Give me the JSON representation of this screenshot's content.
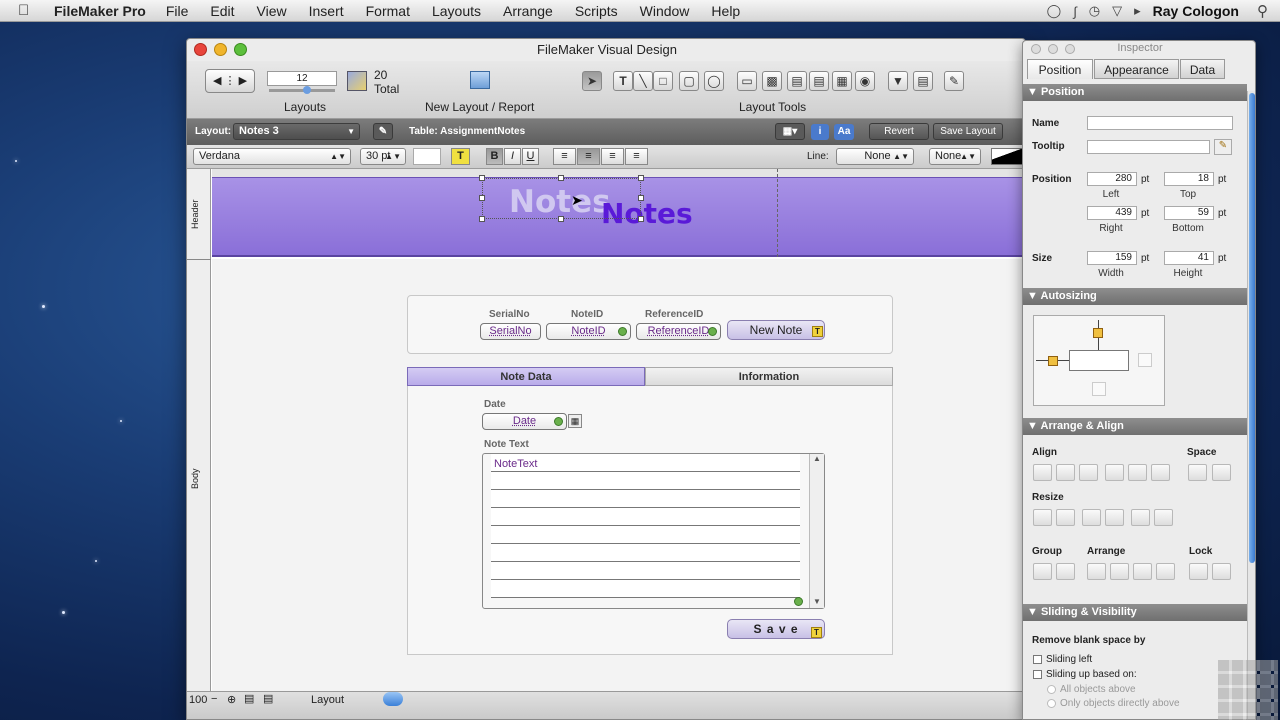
{
  "menubar": {
    "app": "FileMaker Pro",
    "items": [
      "File",
      "Edit",
      "View",
      "Insert",
      "Format",
      "Layouts",
      "Arrange",
      "Scripts",
      "Window",
      "Help"
    ],
    "user": "Ray Cologon"
  },
  "window": {
    "title": "FileMaker Visual Design"
  },
  "toolbar": {
    "record_number": "12",
    "total_count": "20",
    "total_label": "Total",
    "layouts_label": "Layouts",
    "new_layout_label": "New Layout / Report",
    "layout_tools_label": "Layout Tools"
  },
  "statusbar": {
    "layout_prefix": "Layout:",
    "layout_name": "Notes 3",
    "table_label": "Table: AssignmentNotes",
    "revert": "Revert",
    "save_layout": "Save Layout"
  },
  "formatbar": {
    "font": "Verdana",
    "size": "30 pt",
    "line_label": "Line:",
    "line_value": "None",
    "fill_value": "None"
  },
  "parts": {
    "header": "Header",
    "body": "Body"
  },
  "header": {
    "title_shadow": "Notes",
    "title": "Notes"
  },
  "fields": {
    "serial_label": "SerialNo",
    "serial_field": "SerialNo",
    "noteid_label": "NoteID",
    "noteid_field": "NoteID",
    "ref_label": "ReferenceID",
    "ref_field": "ReferenceID",
    "new_note": "New Note"
  },
  "tabs": [
    "Note Data",
    "Information"
  ],
  "notedata": {
    "date_label": "Date",
    "date_field": "Date",
    "notetext_label": "Note Text",
    "notetext_field": "NoteText",
    "save": "S a v e"
  },
  "bottombar": {
    "zoom": "100",
    "mode": "Layout"
  },
  "inspector": {
    "title": "Inspector",
    "tabs": [
      "Position",
      "Appearance",
      "Data"
    ],
    "sections": {
      "position": "Position",
      "autosizing": "Autosizing",
      "arrange": "Arrange & Align",
      "sliding": "Sliding & Visibility"
    },
    "name_label": "Name",
    "tooltip_label": "Tooltip",
    "position_label": "Position",
    "size_label": "Size",
    "left": "280",
    "top": "18",
    "right": "439",
    "bottom": "59",
    "width": "159",
    "height": "41",
    "unit": "pt",
    "left_lbl": "Left",
    "top_lbl": "Top",
    "right_lbl": "Right",
    "bottom_lbl": "Bottom",
    "width_lbl": "Width",
    "height_lbl": "Height",
    "align": "Align",
    "space": "Space",
    "resize": "Resize",
    "group": "Group",
    "arrange_lbl": "Arrange",
    "lock": "Lock",
    "remove_blank": "Remove blank space by",
    "sliding_left": "Sliding left",
    "sliding_up": "Sliding up based on:",
    "all_objects": "All objects above",
    "only_objects": "Only objects directly above"
  }
}
